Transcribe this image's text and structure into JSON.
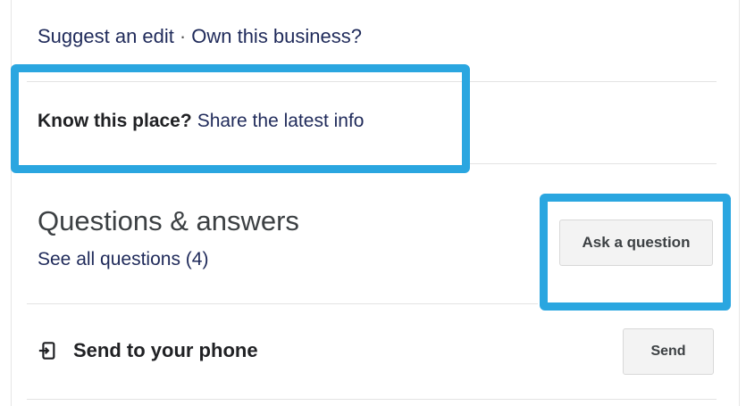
{
  "top_links": {
    "suggest_edit": "Suggest an edit",
    "separator": "·",
    "own_business": "Own this business?"
  },
  "know_place": {
    "prompt": "Know this place?",
    "link": "Share the latest info"
  },
  "qa": {
    "title": "Questions & answers",
    "see_all": "See all questions (4)",
    "ask_button": "Ask a question"
  },
  "send": {
    "label": "Send to your phone",
    "button": "Send",
    "icon": "send-to-phone-icon"
  },
  "colors": {
    "highlight": "#2aa6e0",
    "link": "#1f2a5a"
  }
}
